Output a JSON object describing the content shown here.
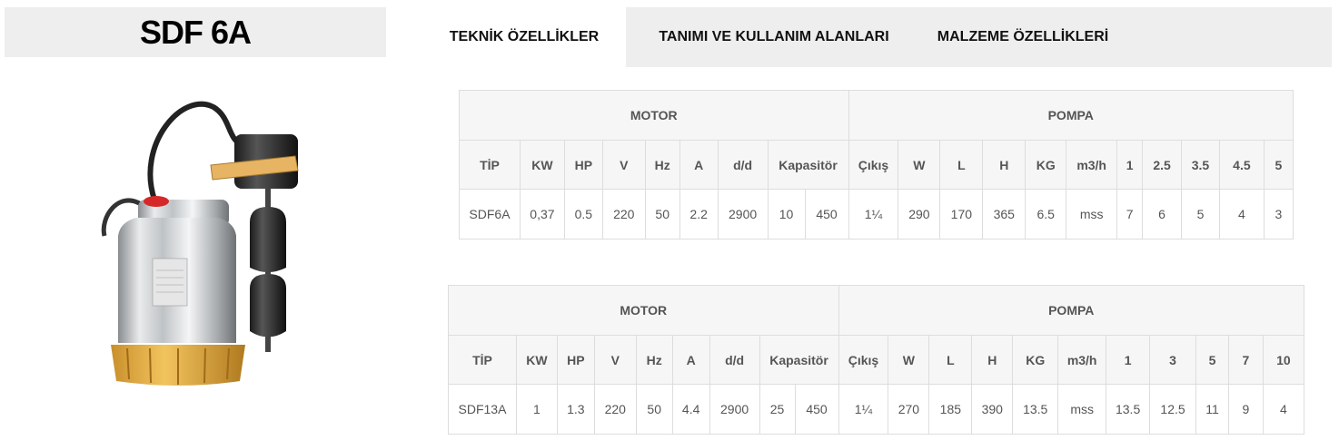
{
  "product_title": "SDF 6A",
  "tabs": [
    {
      "label": "TEKNİK ÖZELLİKLER",
      "active": true
    },
    {
      "label": "TANIMI VE KULLANIM ALANLARI",
      "active": false
    },
    {
      "label": "MALZEME ÖZELLİKLERİ",
      "active": false
    }
  ],
  "tables": [
    {
      "motor_label": "MOTOR",
      "pompa_label": "POMPA",
      "headers": [
        "TİP",
        "KW",
        "HP",
        "V",
        "Hz",
        "A",
        "d/d",
        "Kapasitör",
        "Çıkış",
        "W",
        "L",
        "H",
        "KG",
        "m3/h",
        "1",
        "2.5",
        "3.5",
        "4.5",
        "5"
      ],
      "values": [
        "SDF6A",
        "0,37",
        "0.5",
        "220",
        "50",
        "2.2",
        "2900",
        "10",
        "450",
        "1¼",
        "290",
        "170",
        "365",
        "6.5",
        "mss",
        "7",
        "6",
        "5",
        "4",
        "3"
      ]
    },
    {
      "motor_label": "MOTOR",
      "pompa_label": "POMPA",
      "headers": [
        "TİP",
        "KW",
        "HP",
        "V",
        "Hz",
        "A",
        "d/d",
        "Kapasitör",
        "Çıkış",
        "W",
        "L",
        "H",
        "KG",
        "m3/h",
        "1",
        "3",
        "5",
        "7",
        "10"
      ],
      "values": [
        "SDF13A",
        "1",
        "1.3",
        "220",
        "50",
        "4.4",
        "2900",
        "25",
        "450",
        "1¼",
        "270",
        "185",
        "390",
        "13.5",
        "mss",
        "13.5",
        "12.5",
        "11",
        "9",
        "4"
      ]
    }
  ]
}
